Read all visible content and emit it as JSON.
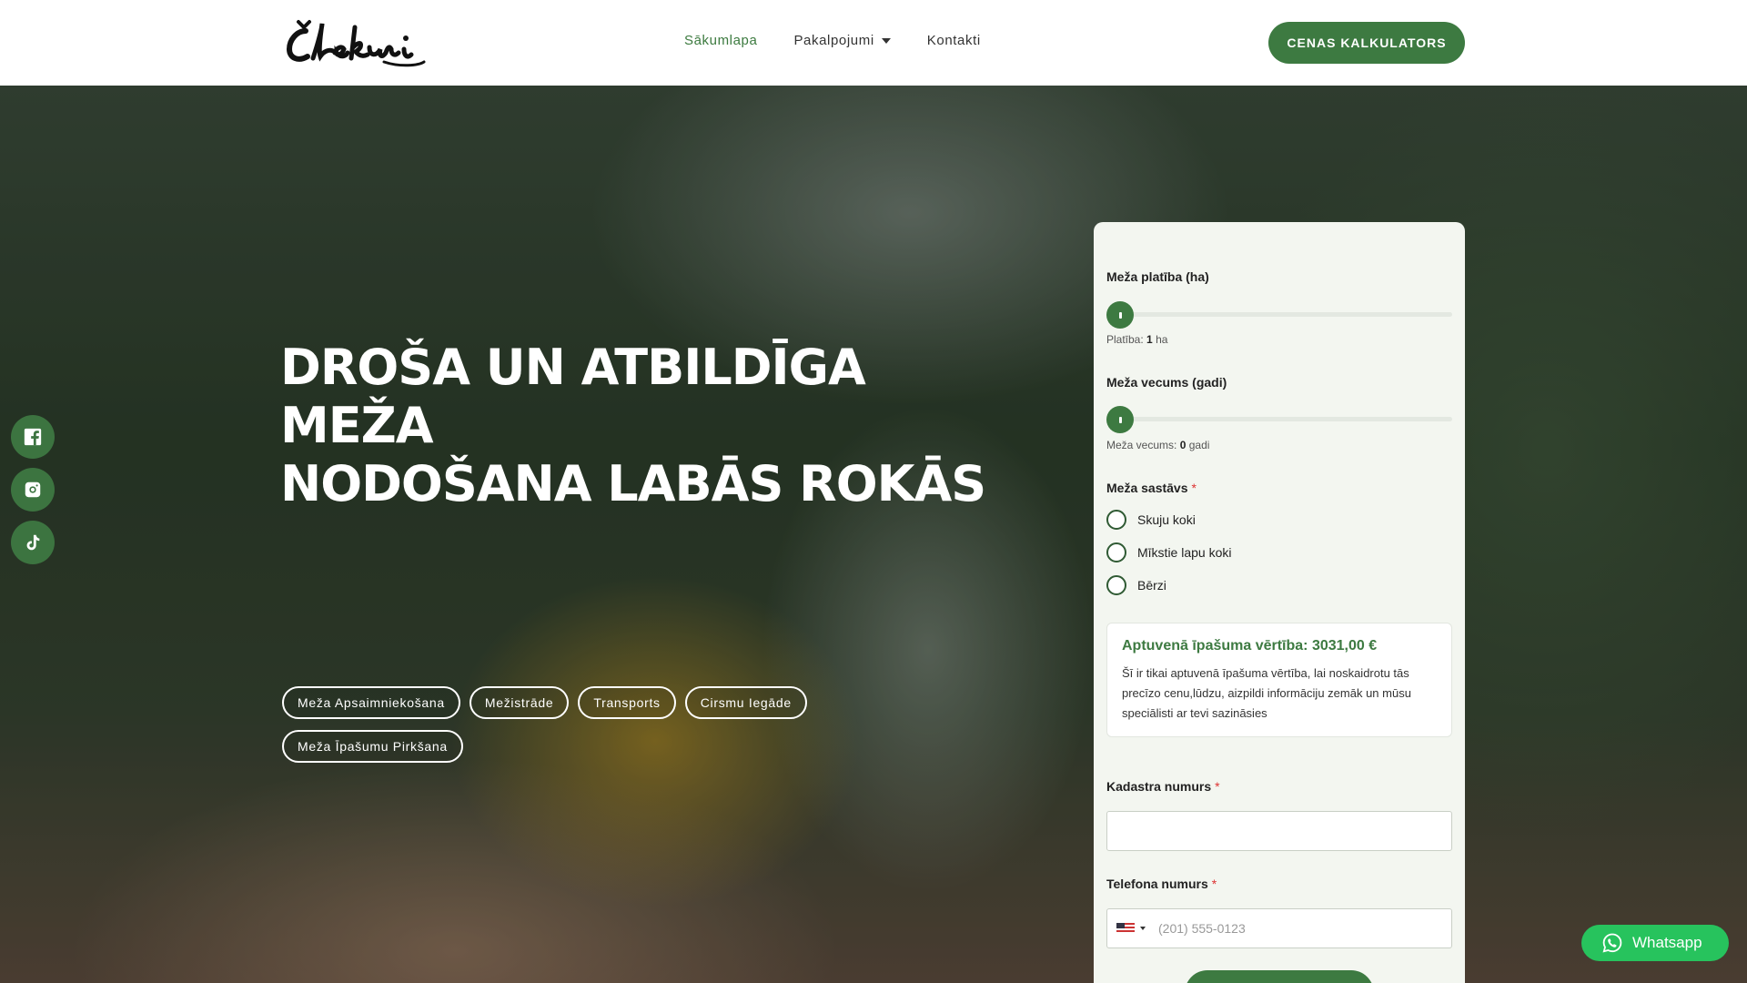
{
  "header": {
    "logo_text": "Čiekuri",
    "nav": [
      {
        "label": "Sākumlapa",
        "active": true
      },
      {
        "label": "Pakalpojumi",
        "dropdown": true
      },
      {
        "label": "Kontakti"
      }
    ],
    "cta_label": "CENAS KALKULATORS"
  },
  "hero": {
    "title_line1": "DROŠA UN ATBILDĪGA MEŽA",
    "title_line2": "NODOŠANA LABĀS ROKĀS",
    "services": [
      "Meža Apsaimniekošana",
      "Mežistrāde",
      "Transports",
      "Cirsmu Iegāde",
      "Meža Īpašumu Pirkšana"
    ]
  },
  "social": [
    "facebook-icon",
    "instagram-icon",
    "tiktok-icon"
  ],
  "form": {
    "area_label": "Meža platība (ha)",
    "area_hint_prefix": "Platība:",
    "area_value": "1",
    "area_unit": "ha",
    "area_fraction": 0.0,
    "age_label": "Meža vecums (gadi)",
    "age_hint_prefix": "Meža vecums:",
    "age_value": "0",
    "age_unit": "gadi",
    "age_fraction": 0.0,
    "composition_label": "Meža sastāvs",
    "required_mark": "*",
    "composition_options": [
      "Skuju koki",
      "Mīkstie lapu koki",
      "Bērzi"
    ],
    "estimate_title": "Aptuvenā īpašuma vērtība: 3031,00 €",
    "estimate_text": "Šī ir tikai aptuvenā īpašuma vērtība, lai noskaidrotu tās precīzo cenu,lūdzu, aizpildi informāciju zemāk un mūsu speciālisti ar tevi sazināsies",
    "cadastre_label": "Kadastra numurs",
    "phone_label": "Telefona numurs",
    "phone_placeholder": "(201) 555-0123"
  },
  "whatsapp_label": "Whatsapp",
  "colors": {
    "brand_green": "#3d7a41",
    "whatsapp_green": "#27c35d"
  }
}
